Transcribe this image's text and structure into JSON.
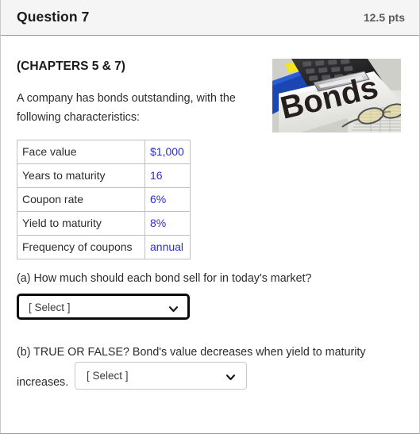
{
  "header": {
    "title": "Question 7",
    "points": "12.5 pts"
  },
  "content": {
    "chapters_heading": "(CHAPTERS 5 & 7)",
    "intro_text": "A company has bonds outstanding, with the following characteristics:",
    "image_caption": "Bonds"
  },
  "table": {
    "rows": [
      {
        "label": "Face value",
        "value": "$1,000"
      },
      {
        "label": "Years to maturity",
        "value": "16"
      },
      {
        "label": "Coupon rate",
        "value": "6%"
      },
      {
        "label": "Yield to maturity",
        "value": "8%"
      },
      {
        "label": "Frequency of coupons",
        "value": "annual"
      }
    ]
  },
  "part_a": {
    "prompt": "(a) How much should each bond sell for in today's market?",
    "select_value": "[ Select ]"
  },
  "part_b": {
    "prompt_before": "(b) TRUE OR FALSE? Bond's value decreases when yield to maturity increases.",
    "select_value": "[ Select ]"
  },
  "colors": {
    "header_background": "#f5f5f5",
    "table_value_text": "#2c2ccc",
    "body_text": "#2c2c2c",
    "points_text": "#5b5b5b",
    "focused_select_border": "#0a0a0a",
    "select_border": "#c9c9c9"
  }
}
